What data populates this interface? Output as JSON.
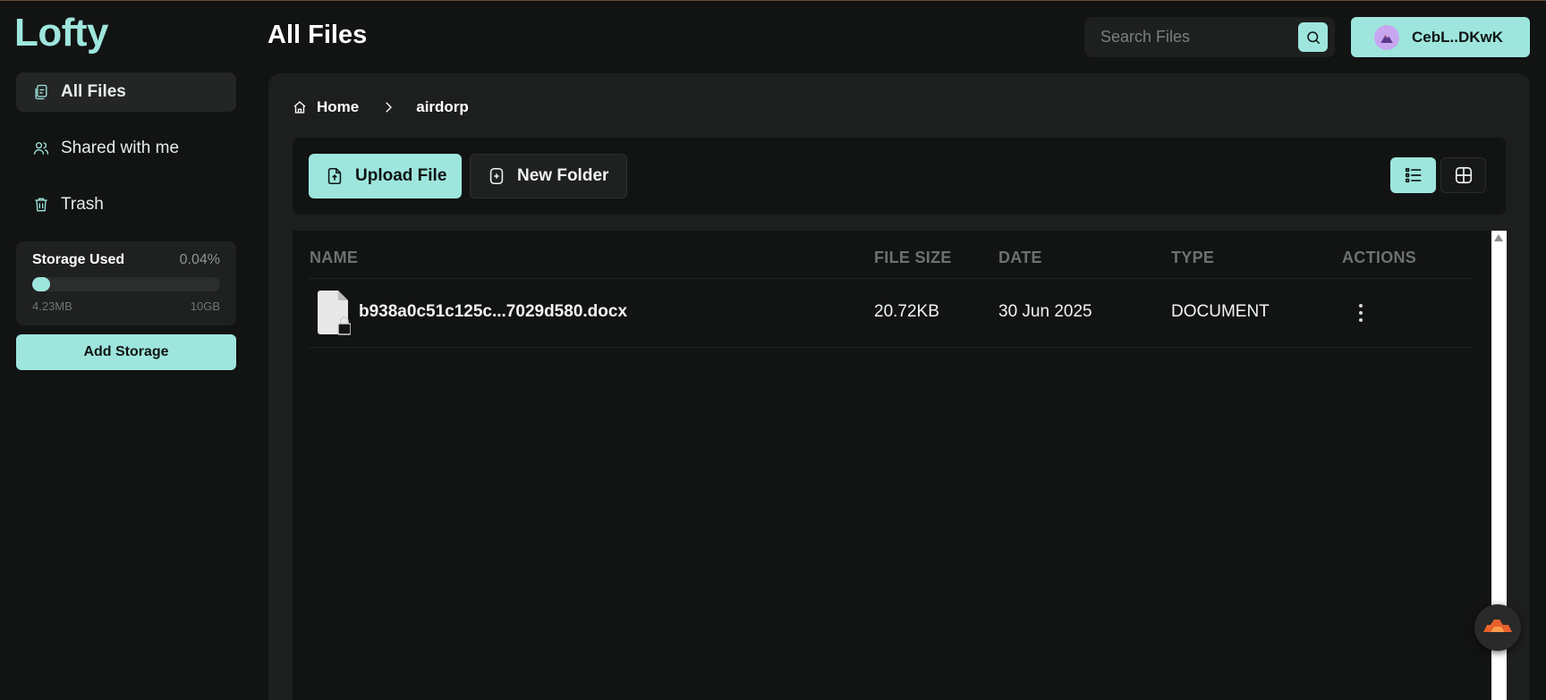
{
  "app": {
    "logo": "Lofty"
  },
  "sidebar": {
    "items": [
      {
        "label": "All Files",
        "icon": "files-icon",
        "active": true
      },
      {
        "label": "Shared with me",
        "icon": "users-icon",
        "active": false
      },
      {
        "label": "Trash",
        "icon": "trash-icon",
        "active": false
      }
    ],
    "storage": {
      "title": "Storage Used",
      "percent_label": "0.04%",
      "used": "4.23MB",
      "total": "10GB",
      "fill_fraction": 0.0004
    },
    "add_storage_label": "Add Storage"
  },
  "header": {
    "title": "All Files",
    "search": {
      "placeholder": "Search Files",
      "value": ""
    },
    "wallet_label": "CebL..DKwK"
  },
  "breadcrumb": {
    "home": "Home",
    "current": "airdorp"
  },
  "toolbar": {
    "upload_label": "Upload File",
    "new_folder_label": "New Folder",
    "view_mode": "list"
  },
  "table": {
    "columns": [
      "NAME",
      "FILE SIZE",
      "DATE",
      "TYPE",
      "ACTIONS"
    ],
    "rows": [
      {
        "name": "b938a0c51c125c...7029d580.docx",
        "size": "20.72KB",
        "date": "30 Jun 2025",
        "type": "DOCUMENT"
      }
    ]
  },
  "colors": {
    "accent": "#9ee6dd",
    "background": "#121313",
    "panel": "#1d1e1e"
  }
}
